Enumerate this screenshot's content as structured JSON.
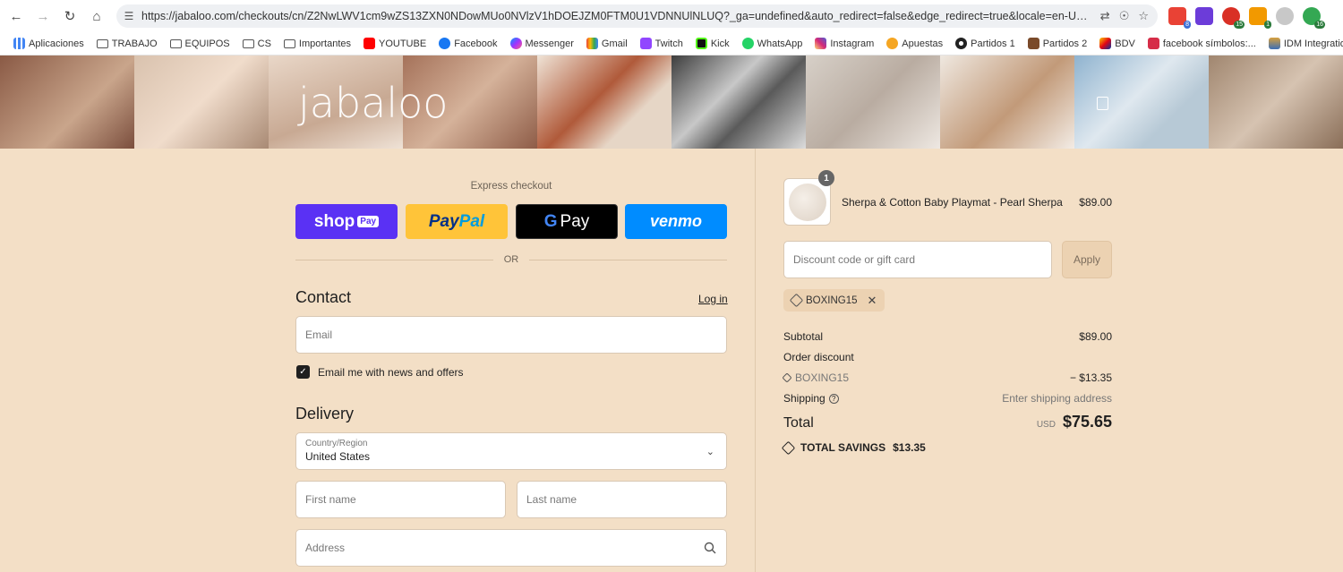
{
  "browser": {
    "url": "https://jabaloo.com/checkouts/cn/Z2NwLWV1cm9wZS13ZXN0NDowMUo0NVlzV1hDOEJZM0FTM0U1VDNNUlNLUQ?_ga=undefined&auto_redirect=false&edge_redirect=true&locale=en-US&skip_shop_..."
  },
  "bookmarks": [
    {
      "label": "Aplicaciones",
      "icon": "apps-icon"
    },
    {
      "label": "TRABAJO",
      "icon": "folder-icon"
    },
    {
      "label": "EQUIPOS",
      "icon": "folder-icon"
    },
    {
      "label": "CS",
      "icon": "folder-icon"
    },
    {
      "label": "Importantes",
      "icon": "folder-icon"
    },
    {
      "label": "YOUTUBE",
      "icon": "youtube-icon"
    },
    {
      "label": "Facebook",
      "icon": "facebook-icon"
    },
    {
      "label": "Messenger",
      "icon": "messenger-icon"
    },
    {
      "label": "Gmail",
      "icon": "gmail-icon"
    },
    {
      "label": "Twitch",
      "icon": "twitch-icon"
    },
    {
      "label": "Kick",
      "icon": "kick-icon"
    },
    {
      "label": "WhatsApp",
      "icon": "whatsapp-icon"
    },
    {
      "label": "Instagram",
      "icon": "instagram-icon"
    },
    {
      "label": "Apuestas",
      "icon": "apuestas-icon"
    },
    {
      "label": "Partidos 1",
      "icon": "ball-icon"
    },
    {
      "label": "Partidos 2",
      "icon": "partidos-icon"
    },
    {
      "label": "BDV",
      "icon": "bdv-icon"
    },
    {
      "label": "facebook símbolos:...",
      "icon": "facebook-symbols-icon"
    },
    {
      "label": "IDM Integration Mo...",
      "icon": "idm-icon"
    }
  ],
  "extensions": {
    "badges": [
      "8",
      "15",
      "1",
      "16"
    ]
  },
  "brand": {
    "logo": "jabaloo"
  },
  "checkout": {
    "express_label": "Express checkout",
    "shoppay": "shop",
    "shoppay_tag": "Pay",
    "paypal_a": "Pay",
    "paypal_b": "Pal",
    "gpay_g": "G",
    "gpay": "Pay",
    "venmo": "venmo",
    "or": "OR",
    "contact_title": "Contact",
    "login": "Log in",
    "email_placeholder": "Email",
    "newsletter_label": "Email me with news and offers",
    "delivery_title": "Delivery",
    "country_label": "Country/Region",
    "country_value": "United States",
    "first_name_placeholder": "First name",
    "last_name_placeholder": "Last name",
    "address_placeholder": "Address"
  },
  "order": {
    "quantity": "1",
    "product_name": "Sherpa & Cotton Baby Playmat - Pearl Sherpa",
    "product_price": "$89.00",
    "discount_placeholder": "Discount code or gift card",
    "apply_label": "Apply",
    "applied_code": "BOXING15",
    "subtotal_label": "Subtotal",
    "subtotal_value": "$89.00",
    "order_discount_label": "Order discount",
    "discount_code": "BOXING15",
    "discount_value": "− $13.35",
    "shipping_label": "Shipping",
    "shipping_value": "Enter shipping address",
    "total_label": "Total",
    "total_currency": "USD",
    "total_value": "$75.65",
    "savings_label": "TOTAL SAVINGS",
    "savings_value": "$13.35"
  },
  "colors": {
    "page_bg": "#f3dfc6",
    "shoppay": "#5a31f4",
    "paypal": "#ffc439",
    "venmo": "#008cff"
  }
}
